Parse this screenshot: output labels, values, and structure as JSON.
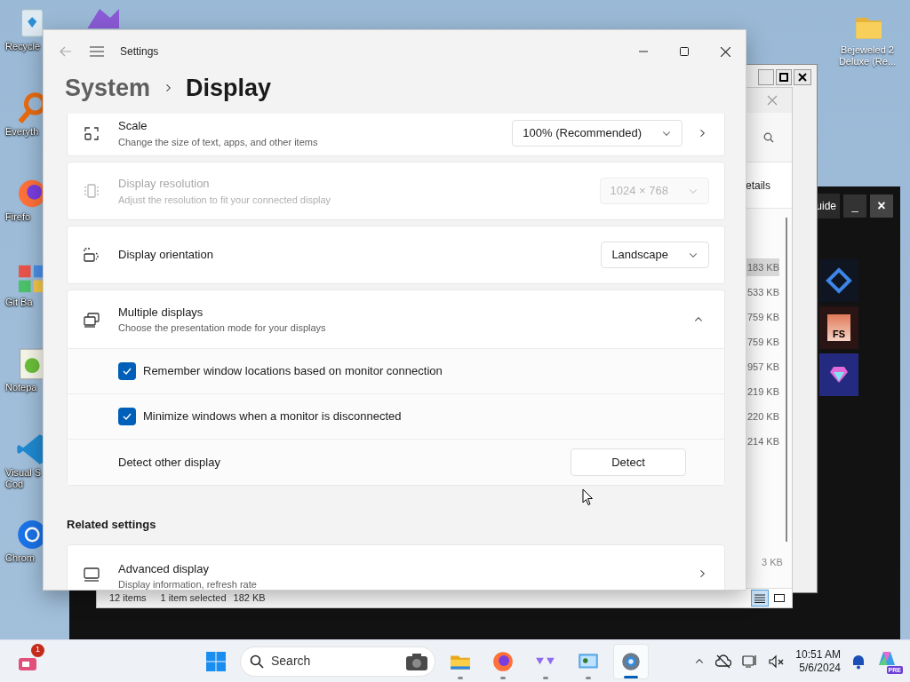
{
  "desktop_icons": [
    {
      "kind": "recycle",
      "lines": [
        "Recycle"
      ]
    },
    {
      "kind": "everything",
      "lines": [
        "Everyth"
      ]
    },
    {
      "kind": "firefox",
      "lines": [
        "Firefo"
      ]
    },
    {
      "kind": "git",
      "lines": [
        "Git Ba"
      ]
    },
    {
      "kind": "notepad",
      "lines": [
        "Notepa"
      ]
    },
    {
      "kind": "vscode",
      "lines": [
        "Visual S",
        "Cod"
      ]
    },
    {
      "kind": "chrome",
      "lines": [
        "Chrom"
      ]
    }
  ],
  "desktop_icon_right": {
    "kind": "folder",
    "lines": [
      "Bejeweled 2",
      "Deluxe (Re..."
    ]
  },
  "dark_window": {
    "title": "uide",
    "minimize": "_",
    "close": "×",
    "tiles": [
      {
        "kind": "ps2"
      },
      {
        "kind": "fs",
        "label": "FS"
      },
      {
        "kind": "gem"
      }
    ]
  },
  "explorer": {
    "tab_text": "etails",
    "sizes": [
      {
        "text": "183 KB",
        "selected": true
      },
      {
        "text": "533 KB",
        "selected": false
      },
      {
        "text": "759 KB",
        "selected": false
      },
      {
        "text": "759 KB",
        "selected": false
      },
      {
        "text": "957 KB",
        "selected": false
      },
      {
        "text": "219 KB",
        "selected": false
      },
      {
        "text": "220 KB",
        "selected": false
      },
      {
        "text": "214 KB",
        "selected": false
      }
    ],
    "last_size": "3 KB",
    "status": [
      "12 items",
      "1 item selected",
      "182 KB"
    ],
    "views": [
      {
        "kind": "details",
        "selected": true
      },
      {
        "kind": "tiles",
        "selected": false
      }
    ]
  },
  "settings": {
    "title": "Settings",
    "breadcrumb": [
      "System",
      "Display"
    ],
    "rows": [
      {
        "kind": "dropdown",
        "title": "Scale",
        "subtitle": "Change the size of text, apps, and other items",
        "value": "100% (Recommended)",
        "disabled": false,
        "chevron": true
      },
      {
        "kind": "dropdown",
        "title": "Display resolution",
        "subtitle": "Adjust the resolution to fit your connected display",
        "value": "1024 × 768",
        "disabled": true,
        "chevron": false
      },
      {
        "kind": "dropdown",
        "title": "Display orientation",
        "value": "Landscape",
        "disabled": false,
        "chevron": false
      },
      {
        "kind": "group",
        "title": "Multiple displays",
        "subtitle": "Choose the presentation mode for your displays",
        "expanded": true,
        "children": [
          {
            "kind": "checkbox",
            "label": "Remember window locations based on monitor connection",
            "checked": true
          },
          {
            "kind": "checkbox",
            "label": "Minimize windows when a monitor is disconnected",
            "checked": true
          },
          {
            "kind": "button",
            "label": "Detect other display",
            "button": "Detect"
          }
        ]
      }
    ],
    "related_title": "Related settings",
    "related": [
      {
        "title": "Advanced display",
        "subtitle": "Display information, refresh rate"
      }
    ]
  },
  "taskbar": {
    "badge": "1",
    "search_placeholder": "Search",
    "apps": [
      {
        "kind": "explorer",
        "running": true,
        "selected": false
      },
      {
        "kind": "firefox",
        "running": true,
        "selected": false
      },
      {
        "kind": "purple",
        "running": true,
        "selected": false
      },
      {
        "kind": "control",
        "running": true,
        "selected": false
      },
      {
        "kind": "settings",
        "running": true,
        "selected": true
      }
    ],
    "time": "10:51 AM",
    "date": "5/6/2024",
    "copilot_label": "PRE"
  }
}
